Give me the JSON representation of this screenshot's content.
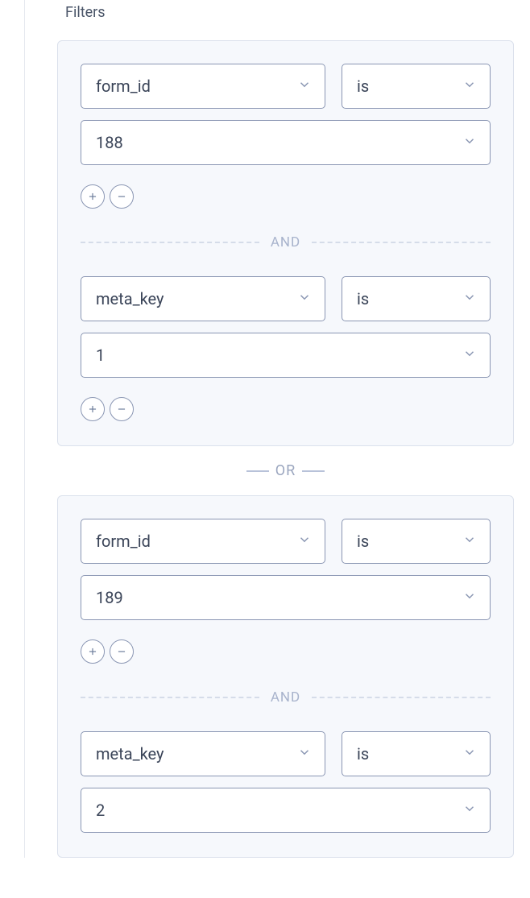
{
  "section_label": "Filters",
  "and_label": "AND",
  "or_label": "OR",
  "groups": [
    {
      "conditions": [
        {
          "field": "form_id",
          "operator": "is",
          "value": "188"
        },
        {
          "field": "meta_key",
          "operator": "is",
          "value": "1"
        }
      ]
    },
    {
      "conditions": [
        {
          "field": "form_id",
          "operator": "is",
          "value": "189"
        },
        {
          "field": "meta_key",
          "operator": "is",
          "value": "2"
        }
      ]
    }
  ]
}
